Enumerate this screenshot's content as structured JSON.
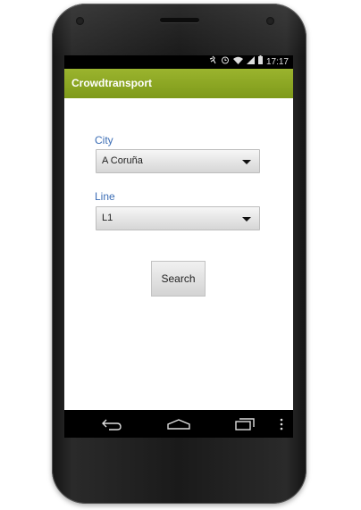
{
  "status_bar": {
    "time": "17:17",
    "icons": [
      "activity-icon",
      "alarm-icon",
      "wifi-icon",
      "signal-icon",
      "battery-icon"
    ]
  },
  "action_bar": {
    "title": "Crowdtransport",
    "color": "#8aa621"
  },
  "form": {
    "city": {
      "label": "City",
      "value": "A Coruña"
    },
    "line": {
      "label": "Line",
      "value": "L1"
    },
    "search_label": "Search",
    "label_color": "#3b6db5"
  },
  "nav_bar": {
    "icons": [
      "back-icon",
      "home-icon",
      "recent-apps-icon",
      "menu-icon"
    ]
  }
}
